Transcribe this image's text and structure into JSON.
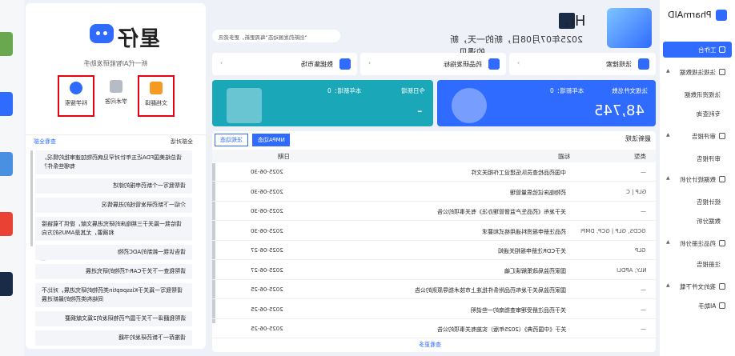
{
  "desktop": {
    "icon_colors": [
      "#6aa84f",
      "#2f6bff",
      "#4a90e2",
      "#e94235",
      "#1a2b48"
    ]
  },
  "left_panel": {
    "brand": "星仔",
    "subtitle": "新一代AI智能研发助手",
    "tools": [
      {
        "label": "文档翻译",
        "icon": "document-icon",
        "color": "#f59b23",
        "highlighted": true
      },
      {
        "label": "学术问答",
        "icon": "page-icon",
        "color": "#b6bcc6",
        "highlighted": false
      },
      {
        "label": "科学搜索",
        "icon": "globe-icon",
        "color": "#2f6bff",
        "highlighted": true
      }
    ],
    "history_label": "全部对话",
    "history_link": "查看全部",
    "questions": [
      "请总结美国FDA近五年针对罕见病药物加速审批的情况，有哪些条件？",
      "请帮我写一个新药申报的综述",
      "介绍一下新药研发管线的进展情况",
      "请给我一篇关于三期临床的研究进展文献，提供下载链接和摘要，尤其是AMUS的方向",
      "请告诉我一款新的ADC药物",
      "请帮我查一下关于CAR-T药物的研究进展",
      "请帮我写一篇关于Kisspeptin类药物的研究进展，对比不同结构类药物的最新进展",
      "请帮我翻译一下关于国产药物研发的2篇文献摘要",
      "请推荐一下新药研发的书籍"
    ]
  },
  "main": {
    "ticker": "“创新药发展动态”每周更新，更多资讯",
    "greeting_hi": "Hi，",
    "greeting_sub": "2025年07月08日，新的一天，新的遇见。",
    "quick_links": [
      {
        "label": "法规搜索",
        "icon": "compass-icon"
      },
      {
        "label": "药品研发指标",
        "icon": "chart-icon"
      },
      {
        "label": "数据集市场",
        "icon": "database-icon"
      }
    ],
    "stats": [
      {
        "label": "法规文件总数",
        "sublabel": "本年新增：0",
        "value": "48,745",
        "color": "#2f6bff"
      },
      {
        "label": "今日新增",
        "sublabel": "本年新增：0",
        "value": "-",
        "color": "#1aa7b8"
      }
    ],
    "table": {
      "title": "最新法规",
      "tabs": [
        "NMPA动态",
        "法规动态"
      ],
      "columns": {
        "type": "类型",
        "title": "标题",
        "date": "日期"
      },
      "rows": [
        {
          "type": "—",
          "title": "中国药品检查员队伍建设工作相关文件",
          "date": "2025-06-30"
        },
        {
          "type": "GLP | C",
          "title": "药物临床试验质量管理",
          "date": "2025-06-30"
        },
        {
          "type": "—",
          "title": "关于发布《药品生产监督管理办法》有关事项的公告",
          "date": "2025-06-30"
        },
        {
          "type": "GCDS, GLP | GCP, DMPI",
          "title": "药品注册申报资料通用格式和要求",
          "date": "2025-06-30"
        },
        {
          "type": "GLP",
          "title": "关于CDR注册申报相关通知",
          "date": "2025-06-27"
        },
        {
          "type": "NLY; APDLI",
          "title": "国家药监局政策解读汇编",
          "date": "2025-06-27"
        },
        {
          "type": "—",
          "title": "国家药监局关于发布药品附条件批准上市技术指导原则的公告",
          "date": "2025-06-25"
        },
        {
          "type": "—",
          "title": "关于药品注册受理审查指南的一些说明",
          "date": "2025-06-25"
        },
        {
          "type": "—",
          "title": "关于《中国药典》（2025年版）实施有关事项的公告",
          "date": "2025-06-25"
        }
      ],
      "more_label": "查看更多"
    }
  },
  "sidebar": {
    "logo": "PharmAID",
    "items": [
      {
        "label": "工作台",
        "active": true,
        "sub": false
      },
      {
        "label": "法规法规数据",
        "active": false,
        "sub": false,
        "expandable": true
      },
      {
        "label": "法规资讯数据",
        "active": false,
        "sub": true
      },
      {
        "label": "专利查询",
        "active": false,
        "sub": true
      },
      {
        "label": "审评报告",
        "active": false,
        "sub": false,
        "expandable": true
      },
      {
        "label": "审评报告",
        "active": false,
        "sub": true
      },
      {
        "label": "数据统计分析",
        "active": false,
        "sub": false,
        "expandable": true
      },
      {
        "label": "统计报告",
        "active": false,
        "sub": true
      },
      {
        "label": "数据分析",
        "active": false,
        "sub": true
      },
      {
        "label": "药品注册分析",
        "active": false,
        "sub": false,
        "expandable": true
      },
      {
        "label": "注册报告",
        "active": false,
        "sub": true
      },
      {
        "label": "我的文件下载",
        "active": false,
        "sub": false,
        "expandable": true
      },
      {
        "label": "AI助手",
        "active": false,
        "sub": false
      }
    ]
  }
}
